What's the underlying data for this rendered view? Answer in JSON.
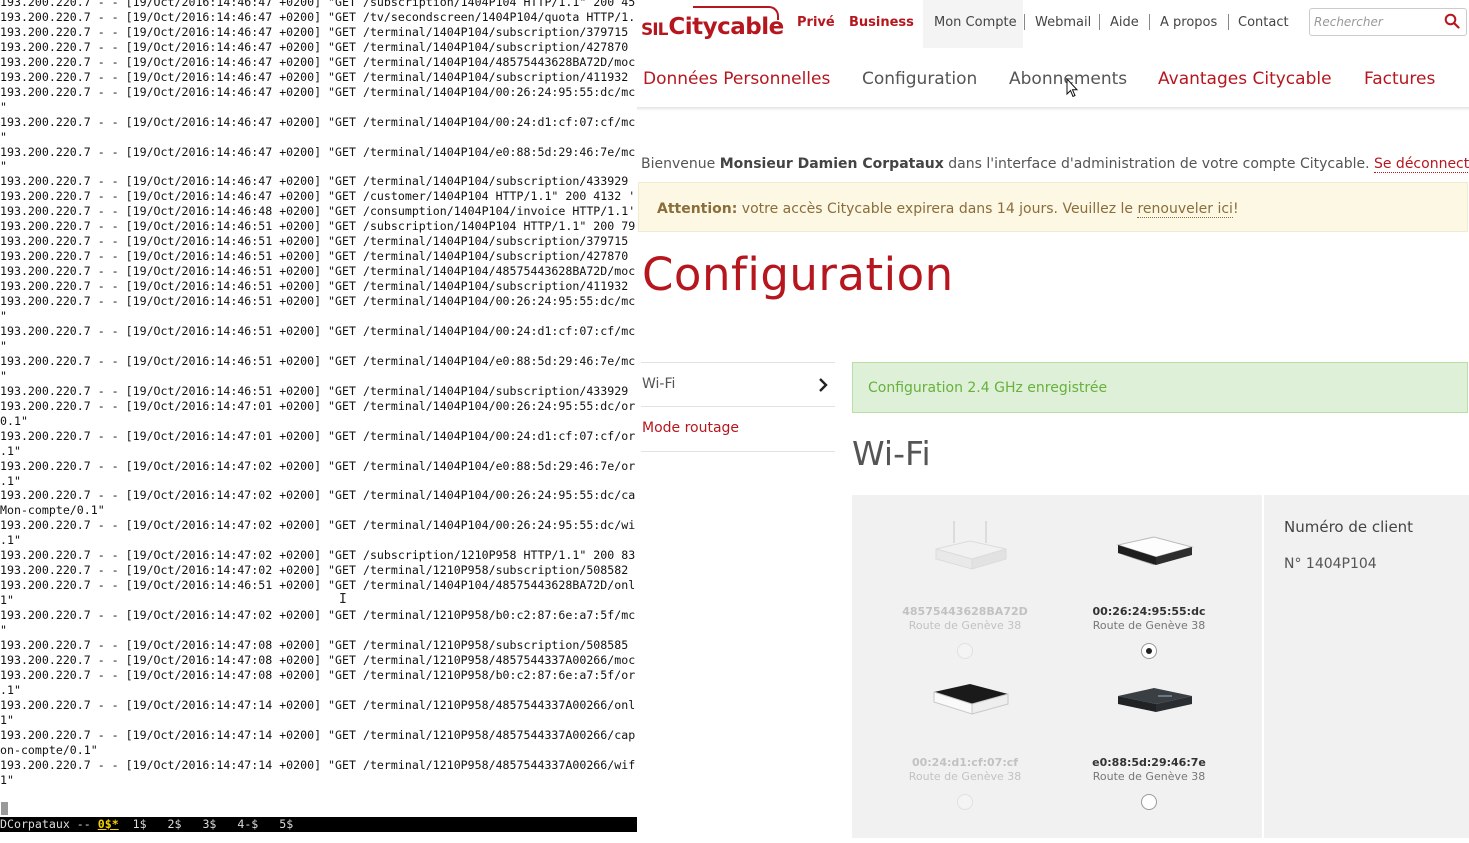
{
  "terminal": {
    "lines": [
      "193.200.220.7 - - [19/Oct/2016:14:46:47 +0200] \"GET /subscription/1404P104 HTTP/1.1\" 200 45",
      "193.200.220.7 - - [19/Oct/2016:14:46:47 +0200] \"GET /tv/secondscreen/1404P104/quota HTTP/1.",
      "193.200.220.7 - - [19/Oct/2016:14:46:47 +0200] \"GET /terminal/1404P104/subscription/379715",
      "193.200.220.7 - - [19/Oct/2016:14:46:47 +0200] \"GET /terminal/1404P104/subscription/427870",
      "193.200.220.7 - - [19/Oct/2016:14:46:47 +0200] \"GET /terminal/1404P104/48575443628BA72D/moc",
      "193.200.220.7 - - [19/Oct/2016:14:46:47 +0200] \"GET /terminal/1404P104/subscription/411932",
      "193.200.220.7 - - [19/Oct/2016:14:46:47 +0200] \"GET /terminal/1404P104/00:26:24:95:55:dc/mc",
      "\"",
      "193.200.220.7 - - [19/Oct/2016:14:46:47 +0200] \"GET /terminal/1404P104/00:24:d1:cf:07:cf/mc",
      "\"",
      "193.200.220.7 - - [19/Oct/2016:14:46:47 +0200] \"GET /terminal/1404P104/e0:88:5d:29:46:7e/mc",
      "\"",
      "193.200.220.7 - - [19/Oct/2016:14:46:47 +0200] \"GET /terminal/1404P104/subscription/433929",
      "193.200.220.7 - - [19/Oct/2016:14:46:47 +0200] \"GET /customer/1404P104 HTTP/1.1\" 200 4132 '",
      "193.200.220.7 - - [19/Oct/2016:14:46:48 +0200] \"GET /consumption/1404P104/invoice HTTP/1.1'",
      "193.200.220.7 - - [19/Oct/2016:14:46:51 +0200] \"GET /subscription/1404P104 HTTP/1.1\" 200 79",
      "193.200.220.7 - - [19/Oct/2016:14:46:51 +0200] \"GET /terminal/1404P104/subscription/379715",
      "193.200.220.7 - - [19/Oct/2016:14:46:51 +0200] \"GET /terminal/1404P104/subscription/427870",
      "193.200.220.7 - - [19/Oct/2016:14:46:51 +0200] \"GET /terminal/1404P104/48575443628BA72D/moc",
      "193.200.220.7 - - [19/Oct/2016:14:46:51 +0200] \"GET /terminal/1404P104/subscription/411932",
      "193.200.220.7 - - [19/Oct/2016:14:46:51 +0200] \"GET /terminal/1404P104/00:26:24:95:55:dc/mc",
      "\"",
      "193.200.220.7 - - [19/Oct/2016:14:46:51 +0200] \"GET /terminal/1404P104/00:24:d1:cf:07:cf/mc",
      "\"",
      "193.200.220.7 - - [19/Oct/2016:14:46:51 +0200] \"GET /terminal/1404P104/e0:88:5d:29:46:7e/mc",
      "\"",
      "193.200.220.7 - - [19/Oct/2016:14:46:51 +0200] \"GET /terminal/1404P104/subscription/433929",
      "193.200.220.7 - - [19/Oct/2016:14:47:01 +0200] \"GET /terminal/1404P104/00:26:24:95:55:dc/or",
      "0.1\"",
      "193.200.220.7 - - [19/Oct/2016:14:47:01 +0200] \"GET /terminal/1404P104/00:24:d1:cf:07:cf/or",
      ".1\"",
      "193.200.220.7 - - [19/Oct/2016:14:47:02 +0200] \"GET /terminal/1404P104/e0:88:5d:29:46:7e/or",
      ".1\"",
      "193.200.220.7 - - [19/Oct/2016:14:47:02 +0200] \"GET /terminal/1404P104/00:26:24:95:55:dc/ca",
      "Mon-compte/0.1\"",
      "193.200.220.7 - - [19/Oct/2016:14:47:02 +0200] \"GET /terminal/1404P104/00:26:24:95:55:dc/wi",
      ".1\"",
      "193.200.220.7 - - [19/Oct/2016:14:47:02 +0200] \"GET /subscription/1210P958 HTTP/1.1\" 200 83",
      "193.200.220.7 - - [19/Oct/2016:14:47:02 +0200] \"GET /terminal/1210P958/subscription/508582",
      "193.200.220.7 - - [19/Oct/2016:14:46:51 +0200] \"GET /terminal/1404P104/48575443628BA72D/onl",
      "1\"",
      "193.200.220.7 - - [19/Oct/2016:14:47:02 +0200] \"GET /terminal/1210P958/b0:c2:87:6e:a7:5f/mc",
      "\"",
      "193.200.220.7 - - [19/Oct/2016:14:47:08 +0200] \"GET /terminal/1210P958/subscription/508585",
      "193.200.220.7 - - [19/Oct/2016:14:47:08 +0200] \"GET /terminal/1210P958/4857544337A00266/moc",
      "193.200.220.7 - - [19/Oct/2016:14:47:08 +0200] \"GET /terminal/1210P958/b0:c2:87:6e:a7:5f/or",
      ".1\"",
      "193.200.220.7 - - [19/Oct/2016:14:47:14 +0200] \"GET /terminal/1210P958/4857544337A00266/onl",
      "1\"",
      "193.200.220.7 - - [19/Oct/2016:14:47:14 +0200] \"GET /terminal/1210P958/4857544337A00266/cap",
      "on-compte/0.1\"",
      "193.200.220.7 - - [19/Oct/2016:14:47:14 +0200] \"GET /terminal/1210P958/4857544337A00266/wif",
      "1\""
    ],
    "status": {
      "session": "DCorpataux -- ",
      "active_window": "0$*",
      "windows": "  1$   2$   3$   4-$   5$"
    }
  },
  "brand": {
    "sil": "SIL",
    "name": "Citycable",
    "color": "#b6171f"
  },
  "header": {
    "segments": [
      "Privé",
      "Business"
    ],
    "top_nav": [
      "Mon Compte",
      "Webmail",
      "Aide",
      "A propos",
      "Contact"
    ],
    "search_placeholder": "Rechercher"
  },
  "main_nav": [
    "Données Personnelles",
    "Configuration",
    "Abonnements",
    "Avantages Citycable",
    "Factures"
  ],
  "welcome": {
    "prefix": "Bienvenue ",
    "name": "Monsieur Damien Corpataux",
    "suffix": " dans l'interface d'administration de votre compte Citycable. ",
    "logout": "Se déconnecter",
    "end": "."
  },
  "alert": {
    "label": "Attention:",
    "text": " votre accès Citycable expirera dans 14 jours. Veuillez le ",
    "link": "renouveler ici",
    "end": "!"
  },
  "page_title": "Configuration",
  "sidebar": {
    "items": [
      "Wi-Fi",
      "Mode routage"
    ]
  },
  "success_message": "Configuration 2.4 GHz enregistrée",
  "section_title": "Wi-Fi",
  "devices": [
    {
      "mac": "48575443628BA72D",
      "address": "Route de Genève 38",
      "selected": false,
      "available": false
    },
    {
      "mac": "00:26:24:95:55:dc",
      "address": "Route de Genève 38",
      "selected": true,
      "available": true
    },
    {
      "mac": "00:24:d1:cf:07:cf",
      "address": "Route de Genève 38",
      "selected": false,
      "available": false
    },
    {
      "mac": "e0:88:5d:29:46:7e",
      "address": "Route de Genève 38",
      "selected": false,
      "available": true
    }
  ],
  "client": {
    "title": "Numéro de client",
    "number": "N° 1404P104"
  }
}
